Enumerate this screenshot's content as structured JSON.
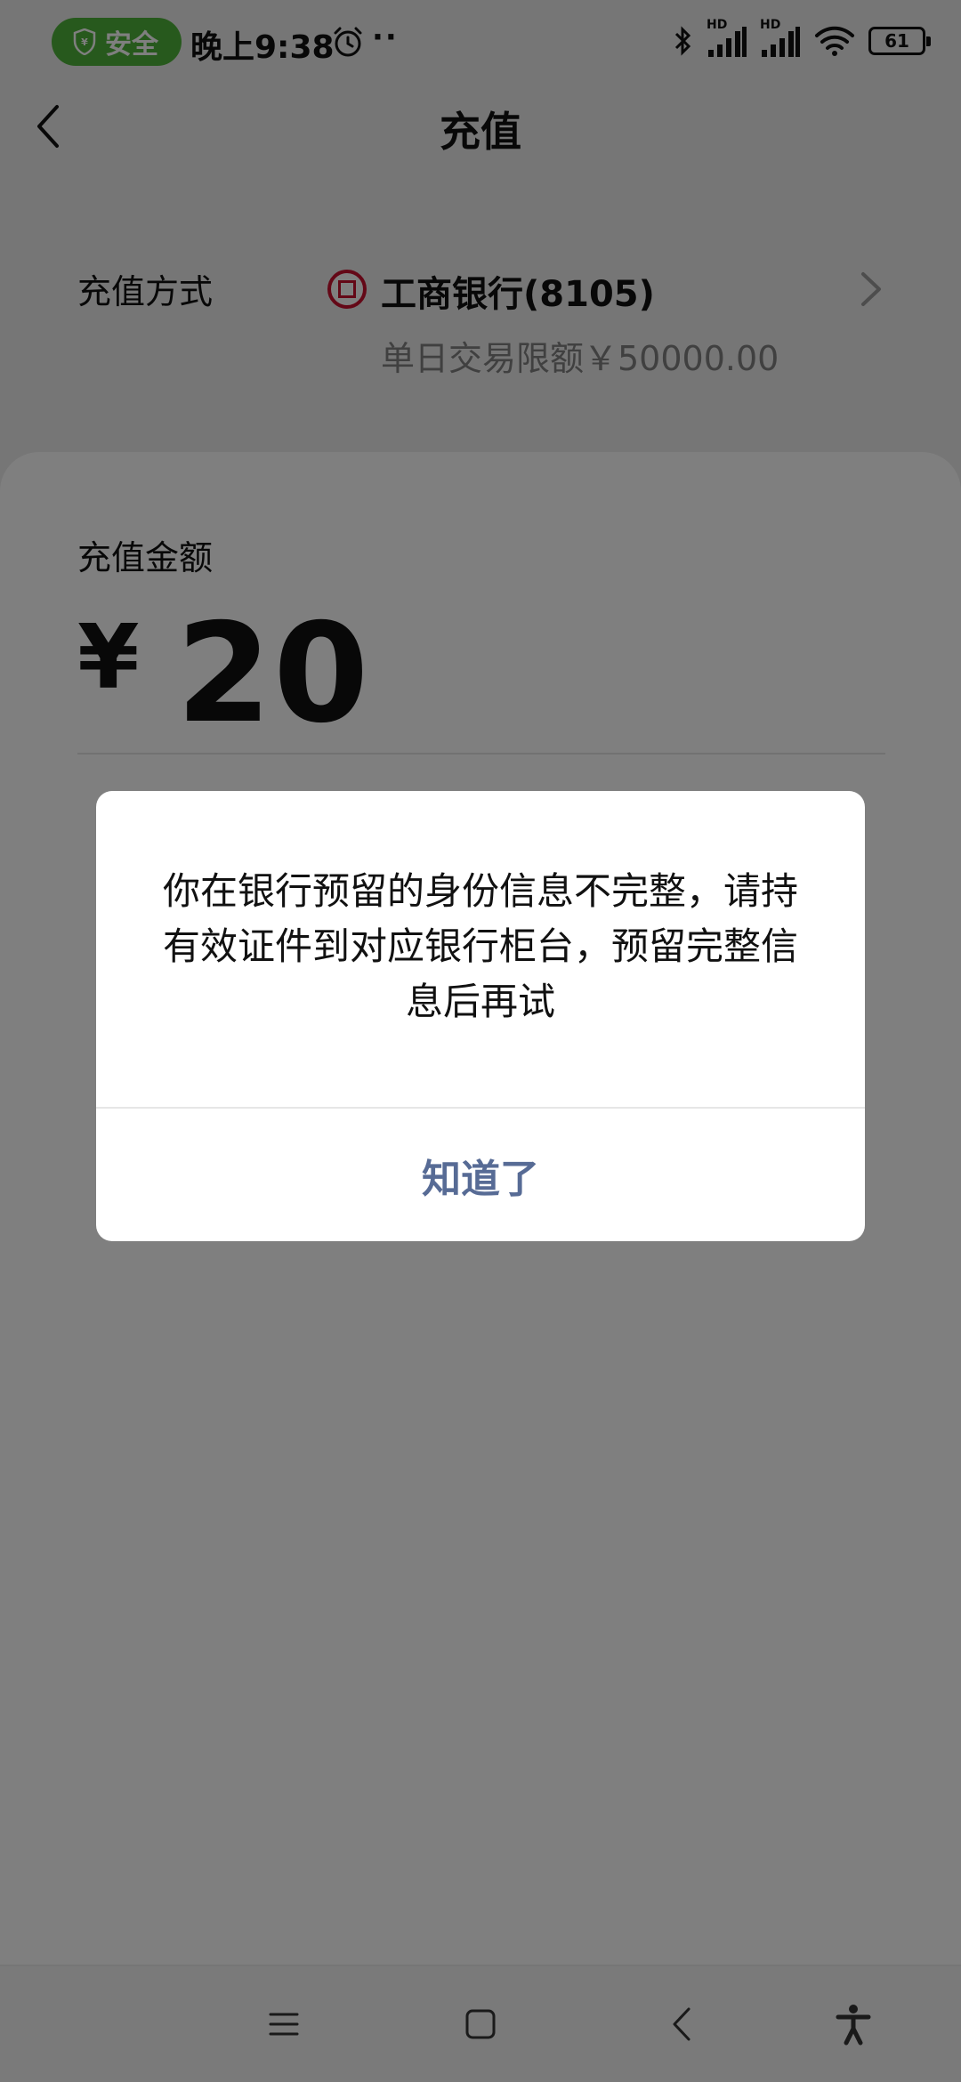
{
  "status_bar": {
    "safe_label": "安全",
    "time": "晚上9:38",
    "dots": "··",
    "hd_1": "HD",
    "hd_2": "HD",
    "battery": "61"
  },
  "nav": {
    "title": "充值"
  },
  "method": {
    "label": "充值方式",
    "bank_name": "工商银行(8105)",
    "limit": "单日交易限额￥50000.00"
  },
  "amount": {
    "label": "充值金额",
    "currency": "¥",
    "value": "20"
  },
  "dialog": {
    "message": "你在银行预留的身份信息不完整，请持有效证件到对应银行柜台，预留完整信息后再试",
    "button": "知道了"
  },
  "colors": {
    "safe_green": "#4fb33a",
    "dialog_button": "#576b95",
    "bank_red": "#c8102e"
  }
}
